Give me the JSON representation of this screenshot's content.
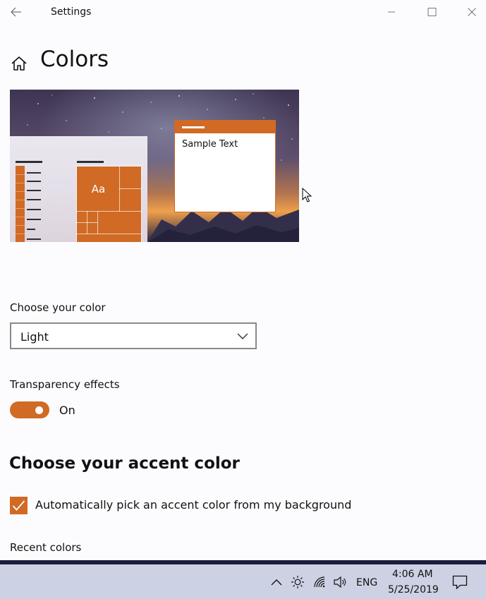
{
  "window": {
    "title": "Settings",
    "back_icon": "back-arrow-icon",
    "controls": [
      "minimize-icon",
      "maximize-icon",
      "close-icon"
    ]
  },
  "page": {
    "home_icon": "home-icon",
    "title": "Colors"
  },
  "preview": {
    "sample_text": "Sample Text",
    "tile_text": "Aa",
    "accent": "#d06a24"
  },
  "color_mode": {
    "label": "Choose your color",
    "selected": "Light"
  },
  "transparency": {
    "label": "Transparency effects",
    "state": "On",
    "enabled": true
  },
  "accent": {
    "heading": "Choose your accent color",
    "auto_pick_label": "Automatically pick an accent color from my background",
    "auto_pick_checked": true,
    "recent_colors_label": "Recent colors"
  },
  "taskbar": {
    "language": "ENG",
    "time": "4:06 AM",
    "date": "5/25/2019",
    "tray_icons": [
      "chevron-up-icon",
      "brightness-icon",
      "wifi-icon",
      "volume-icon",
      "notification-icon"
    ]
  },
  "colors": {
    "accent": "#d06a24",
    "taskbar": "#ccd2e3",
    "background": "#fcfcfe"
  }
}
